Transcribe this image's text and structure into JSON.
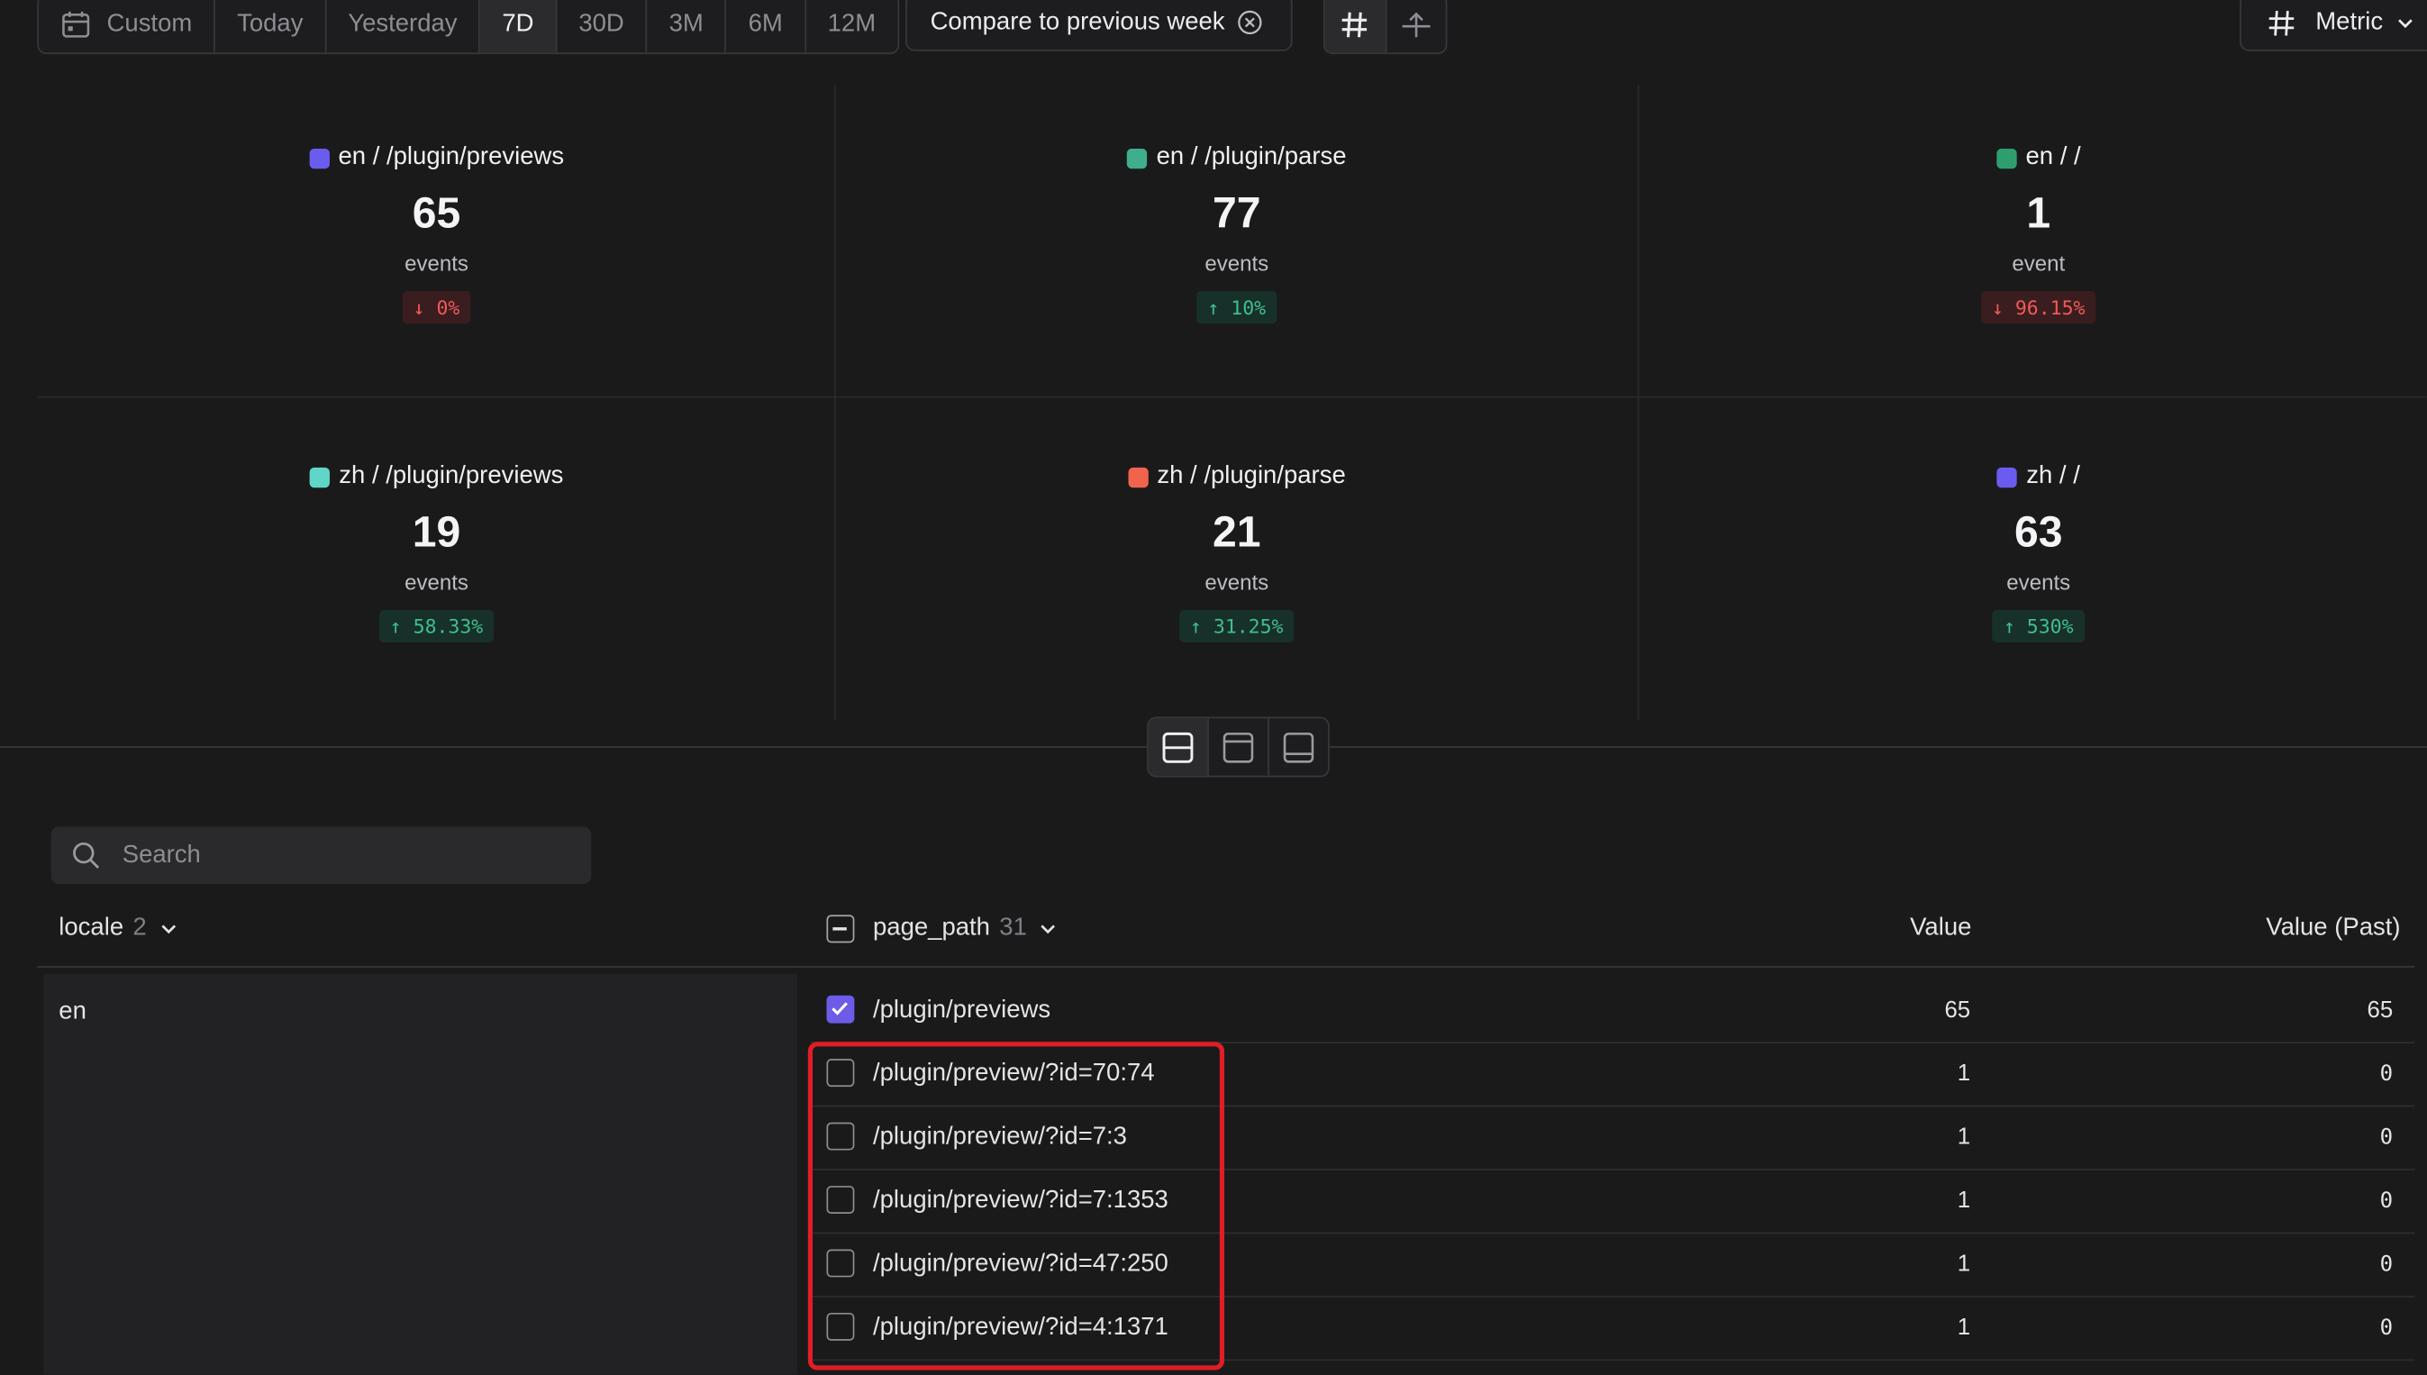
{
  "toolbar": {
    "ranges": [
      "Custom",
      "Today",
      "Yesterday",
      "7D",
      "30D",
      "3M",
      "6M",
      "12M"
    ],
    "active_range": "7D",
    "compare_label": "Compare to previous week",
    "metric_label": "Metric"
  },
  "stats": [
    {
      "label": "en / /plugin/previews",
      "color": "#6b5cf0",
      "value": "65",
      "unit": "events",
      "delta": "↓ 0%",
      "direction": "down"
    },
    {
      "label": "en / /plugin/parse",
      "color": "#3fae8c",
      "value": "77",
      "unit": "events",
      "delta": "↑ 10%",
      "direction": "up"
    },
    {
      "label": "en / /",
      "color": "#2f9e6e",
      "value": "1",
      "unit": "event",
      "delta": "↓ 96.15%",
      "direction": "down"
    },
    {
      "label": "zh / /plugin/previews",
      "color": "#5fd6c8",
      "value": "19",
      "unit": "events",
      "delta": "↑ 58.33%",
      "direction": "up"
    },
    {
      "label": "zh / /plugin/parse",
      "color": "#f0644e",
      "value": "21",
      "unit": "events",
      "delta": "↑ 31.25%",
      "direction": "up"
    },
    {
      "label": "zh / /",
      "color": "#6b5cf0",
      "value": "63",
      "unit": "events",
      "delta": "↑ 530%",
      "direction": "up"
    }
  ],
  "search": {
    "placeholder": "Search"
  },
  "table": {
    "col_locale": "locale",
    "col_locale_count": "2",
    "col_page_path": "page_path",
    "col_page_path_count": "31",
    "col_value": "Value",
    "col_value_past": "Value (Past)",
    "locale_value": "en",
    "rows": [
      {
        "path": "/plugin/previews",
        "value": "65",
        "past": "65",
        "checked": true
      },
      {
        "path": "/plugin/preview/?id=70:74",
        "value": "1",
        "past": "0",
        "checked": false
      },
      {
        "path": "/plugin/preview/?id=7:3",
        "value": "1",
        "past": "0",
        "checked": false
      },
      {
        "path": "/plugin/preview/?id=7:1353",
        "value": "1",
        "past": "0",
        "checked": false
      },
      {
        "path": "/plugin/preview/?id=47:250",
        "value": "1",
        "past": "0",
        "checked": false
      },
      {
        "path": "/plugin/preview/?id=4:1371",
        "value": "1",
        "past": "0",
        "checked": false
      }
    ]
  },
  "colors": {
    "accent": "#6c5ce7",
    "highlight": "#e11d25",
    "up": "#3fbf8f",
    "down": "#f05a5a"
  }
}
